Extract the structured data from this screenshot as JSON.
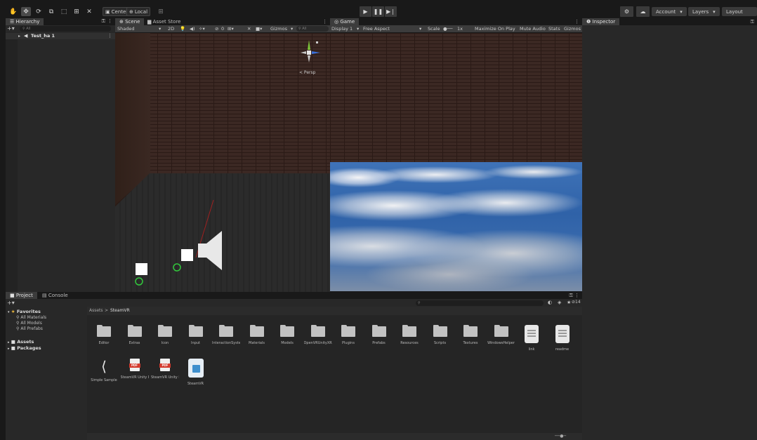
{
  "toolbar": {
    "pivot_label": "Center",
    "space_label": "Local",
    "account_label": "Account",
    "layers_label": "Layers",
    "layout_label": "Layout"
  },
  "hierarchy": {
    "tab_label": "Hierarchy",
    "search_placeholder": "All",
    "scene_name": "Test_ha 1"
  },
  "scene_tabs": {
    "scene": "Scene",
    "asset_store": "Asset Store"
  },
  "scene_toolbar": {
    "shading": "Shaded",
    "mode_2d": "2D",
    "gizmos": "Gizmos",
    "search_placeholder": "All",
    "hidden_count": "0"
  },
  "scene_view": {
    "projection_label": "< Persp"
  },
  "game": {
    "tab_label": "Game",
    "display": "Display 1",
    "aspect": "Free Aspect",
    "scale_label": "Scale",
    "scale_value": "1x",
    "maximize": "Maximize On Play",
    "mute": "Mute Audio",
    "stats": "Stats",
    "gizmos": "Gizmos"
  },
  "inspector": {
    "tab_label": "Inspector"
  },
  "project": {
    "tab_label": "Project",
    "console_tab": "Console",
    "favorites_label": "Favorites",
    "favorites": [
      "All Materials",
      "All Models",
      "All Prefabs"
    ],
    "roots": [
      "Assets",
      "Packages"
    ],
    "breadcrumb_root": "Assets",
    "breadcrumb_sep": ">",
    "breadcrumb_current": "SteamVR",
    "hidden_count": "14",
    "row1": [
      {
        "name": "Editor",
        "kind": "folder"
      },
      {
        "name": "Extras",
        "kind": "folder"
      },
      {
        "name": "Icon",
        "kind": "folder"
      },
      {
        "name": "Input",
        "kind": "folder"
      },
      {
        "name": "InteractionSystem",
        "kind": "folder"
      },
      {
        "name": "Materials",
        "kind": "folder"
      },
      {
        "name": "Models",
        "kind": "folder"
      },
      {
        "name": "OpenVRUnityXR",
        "kind": "folder"
      },
      {
        "name": "Plugins",
        "kind": "folder"
      },
      {
        "name": "Prefabs",
        "kind": "folder"
      },
      {
        "name": "Resources",
        "kind": "folder"
      },
      {
        "name": "Scripts",
        "kind": "folder"
      },
      {
        "name": "Textures",
        "kind": "folder"
      },
      {
        "name": "WindowsHelper",
        "kind": "folder"
      },
      {
        "name": "link",
        "kind": "doc"
      },
      {
        "name": "readme",
        "kind": "doc"
      }
    ],
    "row2": [
      {
        "name": "Simple Sample",
        "kind": "unity"
      },
      {
        "name": "SteamVR Unity Plugin - Input System",
        "kind": "pdf"
      },
      {
        "name": "SteamVR Unity Plugin",
        "kind": "pdf"
      },
      {
        "name": "SteamVR",
        "kind": "package"
      }
    ]
  },
  "colors": {
    "editor_bg": "#191919",
    "panel_bg": "#282828",
    "tab_active": "#3c3c3c",
    "gizmo_y": "#7ec83a",
    "gizmo_x": "#c84040",
    "gizmo_z": "#3a6fd8",
    "collider_green": "#32c83c"
  }
}
